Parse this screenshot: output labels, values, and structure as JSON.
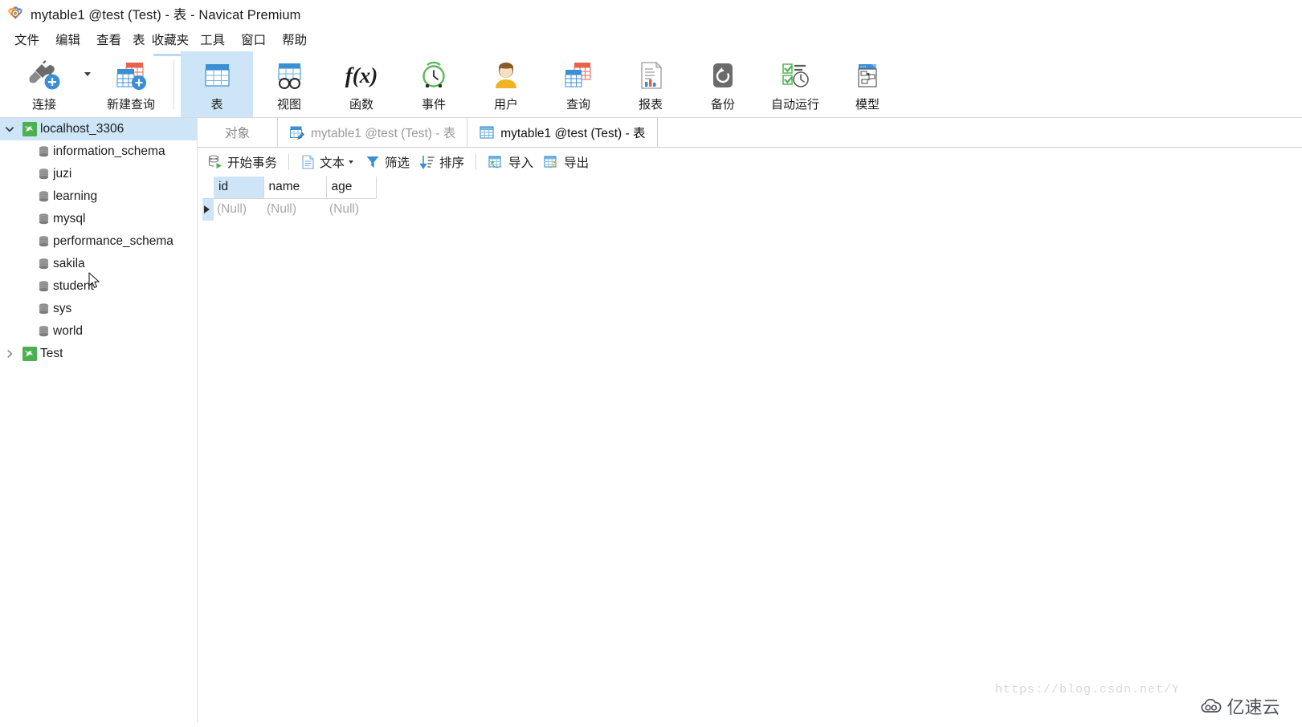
{
  "window": {
    "title": "mytable1 @test (Test) - 表 - Navicat Premium",
    "logo_icon": "navicat-logo-icon"
  },
  "menubar": {
    "items": [
      {
        "label": "文件",
        "name": "menu-file"
      },
      {
        "label": "编辑",
        "name": "menu-edit"
      },
      {
        "label": "查看",
        "name": "menu-view"
      },
      {
        "label": "表",
        "name": "menu-table"
      },
      {
        "label": "收藏夹",
        "name": "menu-favorites"
      },
      {
        "label": "工具",
        "name": "menu-tools"
      },
      {
        "label": "窗口",
        "name": "menu-window"
      },
      {
        "label": "帮助",
        "name": "menu-help"
      }
    ]
  },
  "toolbar": {
    "items": [
      {
        "label": "连接",
        "icon": "connection-plug-icon",
        "active": false
      },
      {
        "label": "新建查询",
        "icon": "new-query-icon",
        "active": false
      },
      {
        "label": "表",
        "icon": "table-icon",
        "active": true
      },
      {
        "label": "视图",
        "icon": "view-icon",
        "active": false
      },
      {
        "label": "函数",
        "icon": "function-fx-icon",
        "active": false
      },
      {
        "label": "事件",
        "icon": "event-clock-icon",
        "active": false
      },
      {
        "label": "用户",
        "icon": "user-icon",
        "active": false
      },
      {
        "label": "查询",
        "icon": "query-icon",
        "active": false
      },
      {
        "label": "报表",
        "icon": "report-icon",
        "active": false
      },
      {
        "label": "备份",
        "icon": "backup-icon",
        "active": false
      },
      {
        "label": "自动运行",
        "icon": "automation-icon",
        "active": false
      },
      {
        "label": "模型",
        "icon": "model-icon",
        "active": false
      }
    ],
    "connection_dropdown_icon": "chevron-down-icon"
  },
  "sidebar": {
    "connections": [
      {
        "label": "localhost_3306",
        "icon": "mysql-dolphin-icon",
        "expanded": true,
        "selected": true,
        "databases": [
          {
            "label": "information_schema",
            "icon": "database-icon"
          },
          {
            "label": "juzi",
            "icon": "database-icon"
          },
          {
            "label": "learning",
            "icon": "database-icon"
          },
          {
            "label": "mysql",
            "icon": "database-icon"
          },
          {
            "label": "performance_schema",
            "icon": "database-icon"
          },
          {
            "label": "sakila",
            "icon": "database-icon"
          },
          {
            "label": "student",
            "icon": "database-icon"
          },
          {
            "label": "sys",
            "icon": "database-icon"
          },
          {
            "label": "world",
            "icon": "database-icon"
          }
        ]
      },
      {
        "label": "Test",
        "icon": "mysql-dolphin-icon",
        "expanded": false,
        "selected": false,
        "databases": []
      }
    ]
  },
  "tabs": [
    {
      "label": "对象",
      "icon": "",
      "state": "objects"
    },
    {
      "label": "mytable1 @test (Test) - 表",
      "icon": "table-design-icon",
      "state": "inactive"
    },
    {
      "label": "mytable1 @test (Test) - 表",
      "icon": "table-data-icon",
      "state": "active"
    }
  ],
  "grid_toolbar": {
    "buttons": [
      {
        "label": "开始事务",
        "icon": "begin-transaction-icon",
        "caret": false
      },
      {
        "label": "文本",
        "icon": "text-document-icon",
        "caret": true
      },
      {
        "label": "筛选",
        "icon": "filter-funnel-icon",
        "caret": false
      },
      {
        "label": "排序",
        "icon": "sort-icon",
        "caret": false
      },
      {
        "label": "导入",
        "icon": "import-icon",
        "caret": false
      },
      {
        "label": "导出",
        "icon": "export-icon",
        "caret": false
      }
    ]
  },
  "datagrid": {
    "columns": [
      {
        "label": "id",
        "selected": true
      },
      {
        "label": "name",
        "selected": false
      },
      {
        "label": "age",
        "selected": false
      }
    ],
    "rows": [
      {
        "current": true,
        "cells": [
          "(Null)",
          "(Null)",
          "(Null)"
        ]
      }
    ]
  },
  "watermark": {
    "url": "https://blog.csdn.net/Y",
    "badge_text": "亿速云",
    "badge_icon": "cloud-icon"
  },
  "colors": {
    "selection_blue": "#cde5f7",
    "accent_blue": "#3b8fd4",
    "mysql_green": "#4CAF50",
    "null_gray": "#a8a8a8"
  }
}
